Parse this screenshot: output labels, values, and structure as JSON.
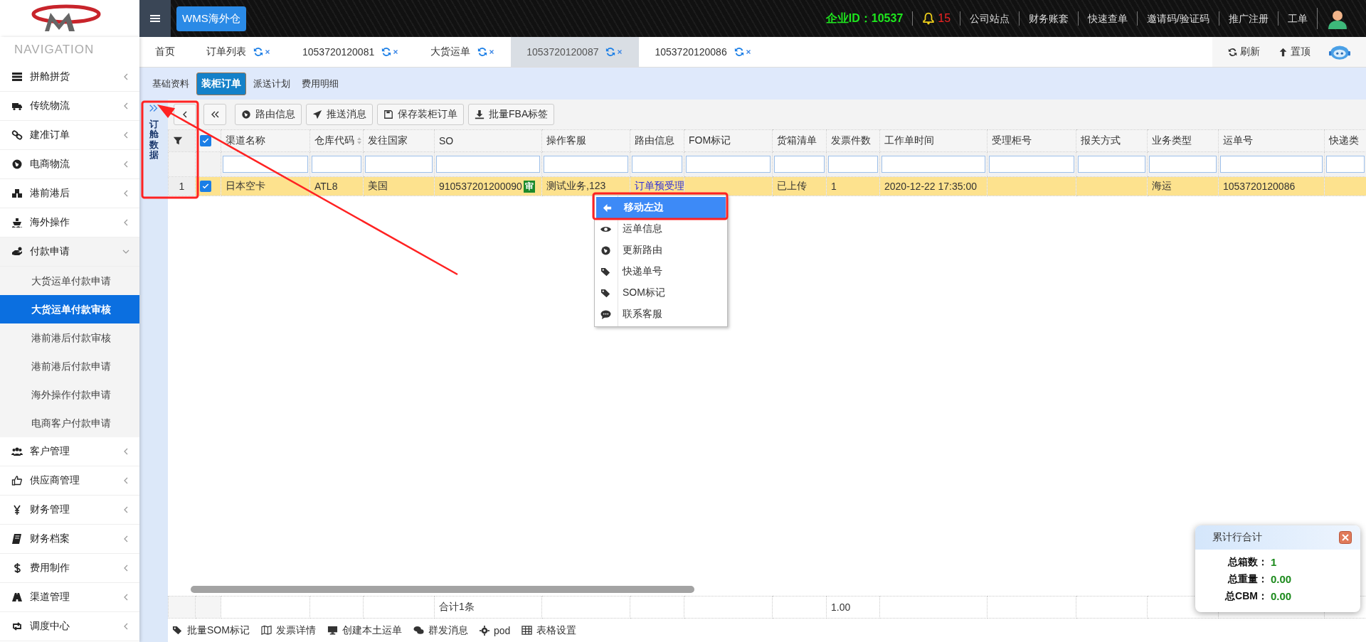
{
  "top_bar": {
    "app_button": "WMS海外仓",
    "company_id": "企业ID：10537",
    "notification_count": "15",
    "links": [
      "公司站点",
      "财务账套",
      "快速查单",
      "邀请码/验证码",
      "推广注册",
      "工单"
    ]
  },
  "sidebar": {
    "header": "NAVIGATION",
    "items": [
      {
        "label": "拼舱拼货",
        "expanded": false
      },
      {
        "label": "传统物流",
        "expanded": false
      },
      {
        "label": "建准订单",
        "expanded": false
      },
      {
        "label": "电商物流",
        "expanded": false
      },
      {
        "label": "港前港后",
        "expanded": false
      },
      {
        "label": "海外操作",
        "expanded": false
      },
      {
        "label": "付款申请",
        "expanded": true,
        "children": [
          {
            "label": "大货运单付款申请",
            "selected": false
          },
          {
            "label": "大货运单付款审核",
            "selected": true
          },
          {
            "label": "港前港后付款审核",
            "selected": false
          },
          {
            "label": "港前港后付款申请",
            "selected": false
          },
          {
            "label": "海外操作付款申请",
            "selected": false
          },
          {
            "label": "电商客户付款申请",
            "selected": false
          }
        ]
      },
      {
        "label": "客户管理",
        "expanded": false
      },
      {
        "label": "供应商管理",
        "expanded": false
      },
      {
        "label": "财务管理",
        "expanded": false
      },
      {
        "label": "财务档案",
        "expanded": false
      },
      {
        "label": "费用制作",
        "expanded": false
      },
      {
        "label": "渠道管理",
        "expanded": false
      },
      {
        "label": "调度中心",
        "expanded": false
      }
    ]
  },
  "tabs": [
    {
      "label": "首页",
      "selected": false,
      "closable": false
    },
    {
      "label": "订单列表",
      "selected": false,
      "closable": true
    },
    {
      "label": "1053720120081",
      "selected": false,
      "closable": true
    },
    {
      "label": "大货运单",
      "selected": false,
      "closable": true
    },
    {
      "label": "1053720120087",
      "selected": true,
      "closable": true
    },
    {
      "label": "1053720120086",
      "selected": false,
      "closable": true
    }
  ],
  "tab_actions": [
    "刷新",
    "置顶"
  ],
  "sub_tabs": [
    {
      "label": "基础资料",
      "selected": false
    },
    {
      "label": "装柜订单",
      "selected": true
    },
    {
      "label": "派送计划",
      "selected": false
    },
    {
      "label": "费用明细",
      "selected": false
    }
  ],
  "side_panel": {
    "title": "订舱数据"
  },
  "actions": [
    "路由信息",
    "推送消息",
    "保存装柜订单",
    "批量FBA标签"
  ],
  "table": {
    "all_checked": true,
    "columns": [
      "渠道名称",
      "仓库代码",
      "发往国家",
      "SO",
      "操作客服",
      "路由信息",
      "FOM标记",
      "货箱清单",
      "发票件数",
      "工作单时间",
      "受理柜号",
      "报关方式",
      "业务类型",
      "运单号",
      "快递类"
    ],
    "rows": [
      {
        "number": "1",
        "checked": true,
        "cells": [
          {
            "kind": "text",
            "text": "日本空卡"
          },
          {
            "kind": "text",
            "text": "ATL8"
          },
          {
            "kind": "text",
            "text": "美国"
          },
          {
            "kind": "badged",
            "text": "910537201200090",
            "badge": "审"
          },
          {
            "kind": "text",
            "text": "测试业务,123"
          },
          {
            "kind": "link",
            "text": "订单预受理"
          },
          {
            "kind": "empty"
          },
          {
            "kind": "text",
            "text": "已上传"
          },
          {
            "kind": "text",
            "text": "1"
          },
          {
            "kind": "text",
            "text": "2020-12-22 17:35:00"
          },
          {
            "kind": "empty"
          },
          {
            "kind": "empty"
          },
          {
            "kind": "text",
            "text": "海运"
          },
          {
            "kind": "text",
            "text": "1053720120086"
          },
          {
            "kind": "empty"
          }
        ]
      }
    ],
    "footer": {
      "total_label": "合计1条",
      "invoice_total": "1.00"
    }
  },
  "context_menu": [
    {
      "label": "移动左边",
      "selected": true
    },
    {
      "label": "运单信息",
      "selected": false
    },
    {
      "label": "更新路由",
      "selected": false
    },
    {
      "label": "快递单号",
      "selected": false
    },
    {
      "label": "SOM标记",
      "selected": false
    },
    {
      "label": "联系客服",
      "selected": false
    }
  ],
  "bottom_actions": [
    "批量SOM标记",
    "发票详情",
    "创建本土运单",
    "群发消息",
    "pod",
    "表格设置"
  ],
  "summary": {
    "title": "累计行合计",
    "rows": [
      {
        "label": "总箱数：",
        "value": "1"
      },
      {
        "label": "总重量：",
        "value": "0.00"
      },
      {
        "label": "总CBM：",
        "value": "0.00"
      }
    ]
  }
}
